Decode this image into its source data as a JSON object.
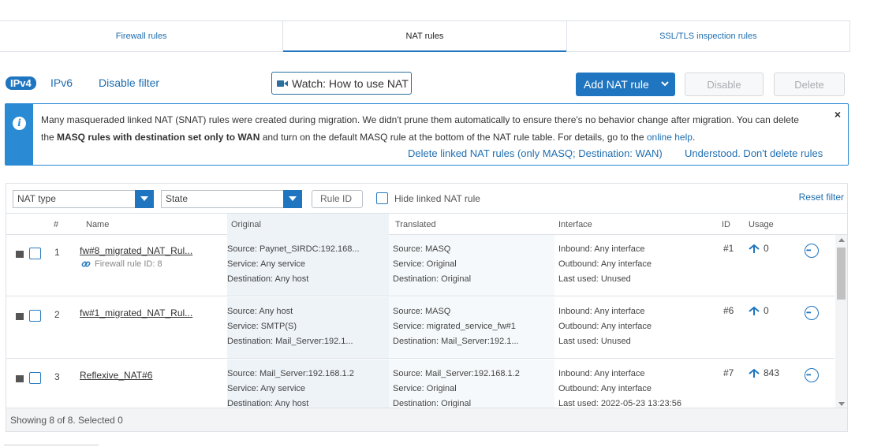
{
  "tabs": [
    {
      "label": "Firewall rules"
    },
    {
      "label": "NAT rules"
    },
    {
      "label": "SSL/TLS inspection rules"
    }
  ],
  "toolbar": {
    "ipv4": "IPv4",
    "ipv6": "IPv6",
    "disable_filter": "Disable filter",
    "watch": "Watch: How to use NAT",
    "add_rule": "Add NAT rule",
    "disable": "Disable",
    "delete": "Delete"
  },
  "banner": {
    "line1": "Many masqueraded linked NAT (SNAT) rules were created during migration. We didn't prune them automatically to ensure there's no behavior change after migration. You can delete",
    "line2_pre": "the ",
    "line2_bold": "MASQ rules with destination set only to WAN",
    "line2_mid": " and turn on the default MASQ rule at the bottom of the NAT rule table. For details, go to the ",
    "line2_link": "online help",
    "line2_end": ".",
    "close": "×",
    "action_delete": "Delete linked NAT rules (only MASQ; Destination: WAN)",
    "action_keep": "Understood. Don't delete rules"
  },
  "filters": {
    "nat_type": "NAT type",
    "state": "State",
    "rule_id_placeholder": "Rule ID",
    "hide_linked": "Hide linked NAT rule",
    "reset": "Reset filter"
  },
  "table": {
    "headers": {
      "num": "#",
      "name": "Name",
      "original": "Original",
      "translated": "Translated",
      "interface": "Interface",
      "id": "ID",
      "usage": "Usage"
    },
    "rows": [
      {
        "num": "1",
        "name": "fw#8_migrated_NAT_Rul...",
        "linked": "Firewall rule ID: 8",
        "orig": [
          "Source: Paynet_SIRDC:192.168...",
          "Service: Any service",
          "Destination: Any host"
        ],
        "trans": [
          "Source: MASQ",
          "Service: Original",
          "Destination: Original"
        ],
        "iface": [
          "Inbound: Any interface",
          "Outbound: Any interface",
          "Last used: Unused"
        ],
        "id": "#1",
        "usage": "0"
      },
      {
        "num": "2",
        "name": "fw#1_migrated_NAT_Rul...",
        "linked": "",
        "orig": [
          "Source: Any host",
          "Service: SMTP(S)",
          "Destination: Mail_Server:192.1..."
        ],
        "trans": [
          "Source: MASQ",
          "Service: migrated_service_fw#1",
          "Destination: Mail_Server:192.1..."
        ],
        "iface": [
          "Inbound: Any interface",
          "Outbound: Any interface",
          "Last used: Unused"
        ],
        "id": "#6",
        "usage": "0"
      },
      {
        "num": "3",
        "name": "Reflexive_NAT#6",
        "linked": "",
        "orig": [
          "Source: Mail_Server:192.168.1.2",
          "Service: Any service",
          "Destination: Any host"
        ],
        "trans": [
          "Source: Mail_Server:192.168.1.2",
          "Service: Original",
          "Destination: Original"
        ],
        "iface": [
          "Inbound: Any interface",
          "Outbound: Any interface",
          "Last used: 2022-05-23 13:23:56"
        ],
        "id": "#7",
        "usage": "843"
      }
    ]
  },
  "footer": {
    "status": "Showing 8 of 8. Selected 0"
  }
}
